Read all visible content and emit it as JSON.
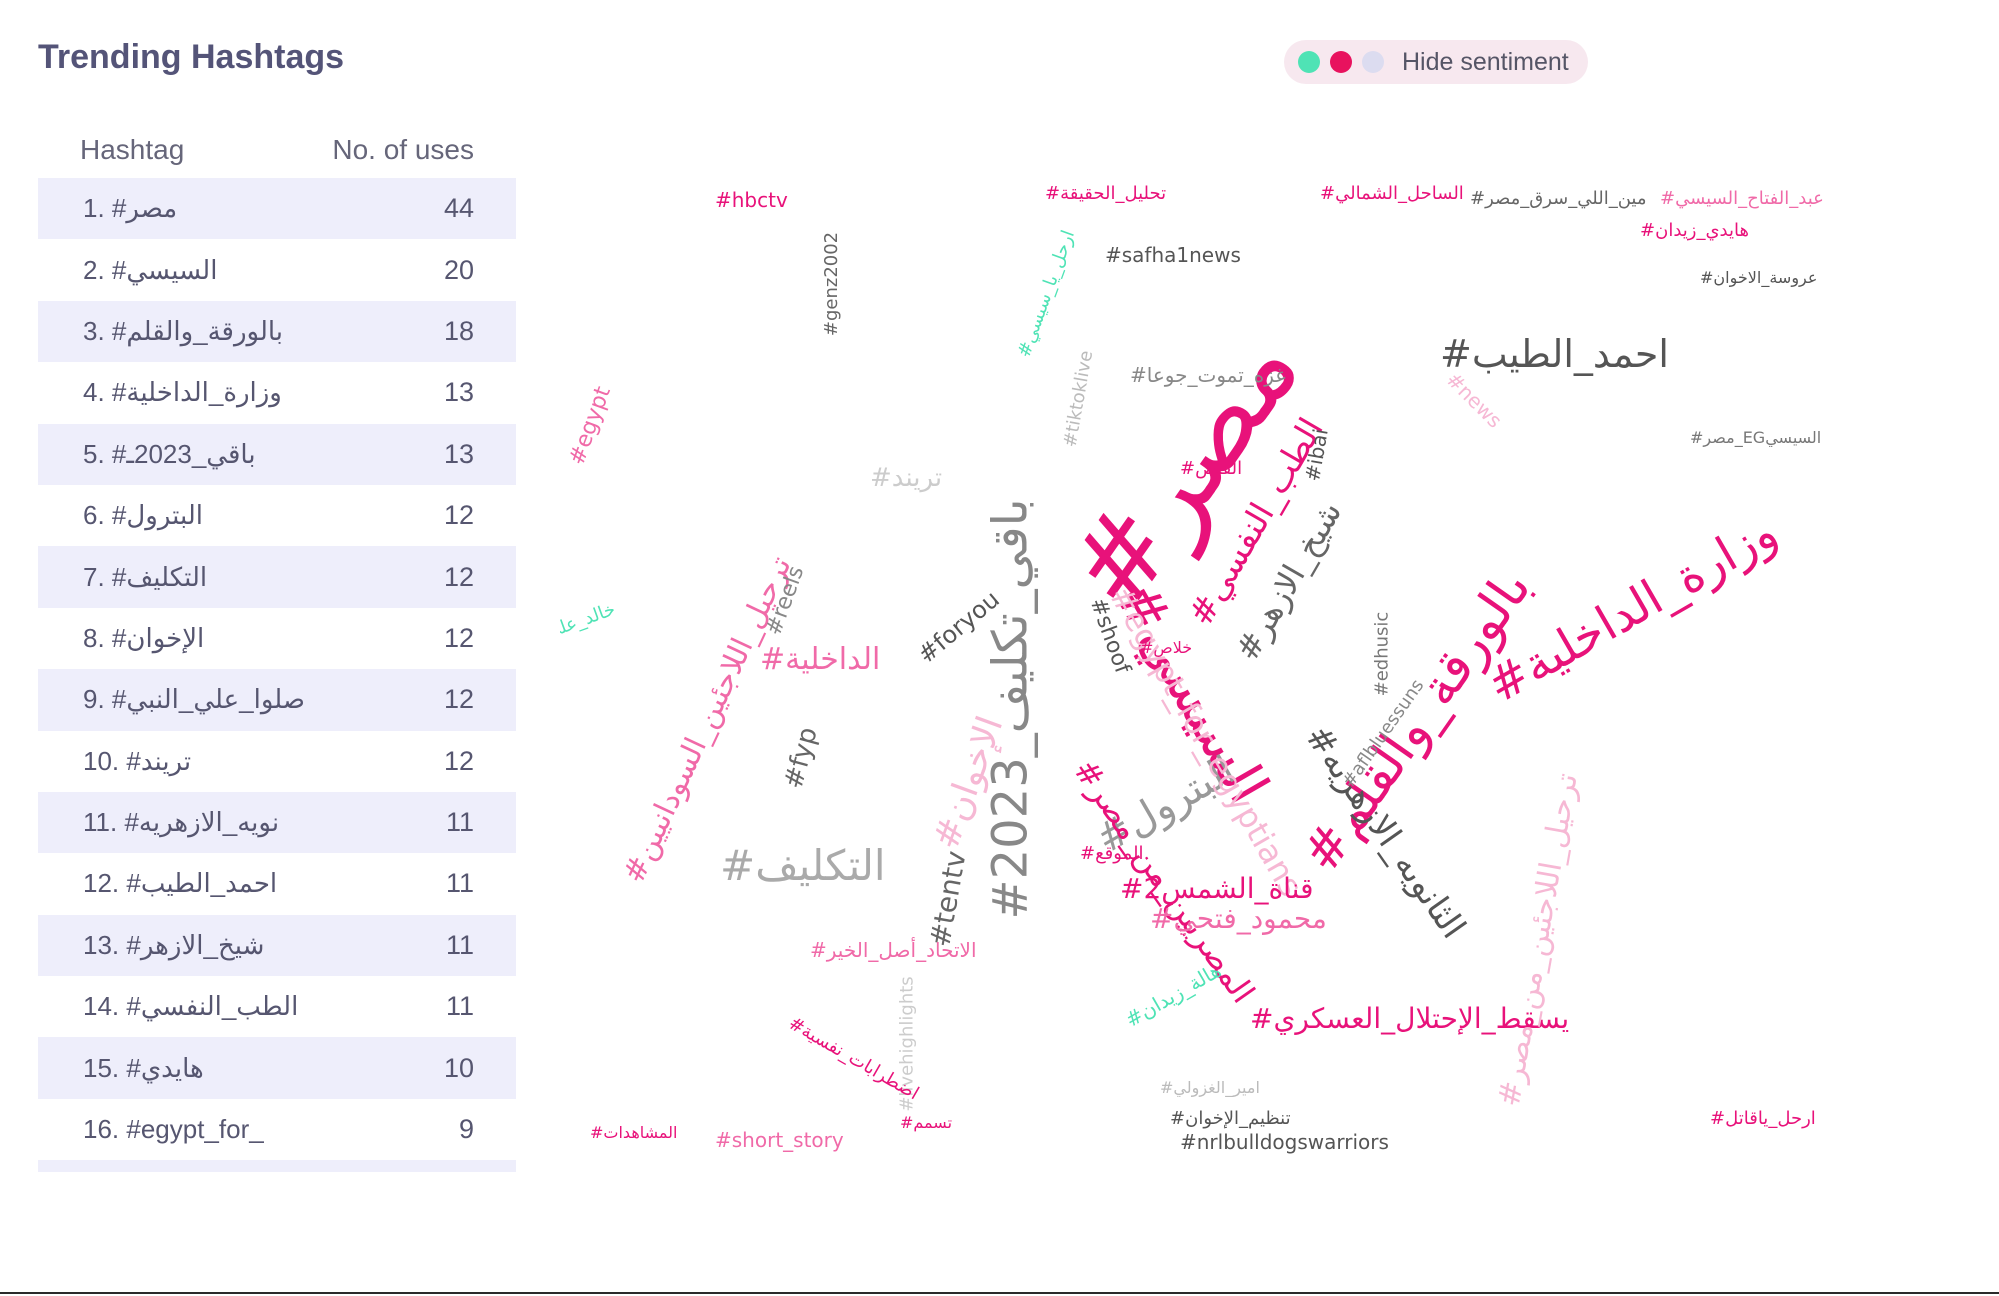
{
  "header": {
    "title": "Trending Hashtags"
  },
  "sentiment_toggle": {
    "label": "Hide sentiment",
    "colors": {
      "positive": "#4fe3b5",
      "negative": "#e8125e",
      "neutral": "#dcdcf0"
    }
  },
  "table": {
    "col_hashtag": "Hashtag",
    "col_uses": "No. of uses",
    "rows": [
      {
        "label": "1. #مصر",
        "uses": "44"
      },
      {
        "label": "2. #السيسي",
        "uses": "20"
      },
      {
        "label": "3. #بالورقة_والقلم",
        "uses": "18"
      },
      {
        "label": "4. #وزارة_الداخلية",
        "uses": "13"
      },
      {
        "label": "5. #باقي_2023ـ",
        "uses": "13"
      },
      {
        "label": "6. #البترول",
        "uses": "12"
      },
      {
        "label": "7. #التكليف",
        "uses": "12"
      },
      {
        "label": "8. #الإخوان",
        "uses": "12"
      },
      {
        "label": "9. #صلوا_علي_النبي",
        "uses": "12"
      },
      {
        "label": "10. #تريند",
        "uses": "12"
      },
      {
        "label": "11. #نويه_الازهريه",
        "uses": "11"
      },
      {
        "label": "12. #احمد_الطيب",
        "uses": "11"
      },
      {
        "label": "13. #شيخ_الازهر",
        "uses": "11"
      },
      {
        "label": "14. #الطب_النفسي",
        "uses": "11"
      },
      {
        "label": "15. #هايدي",
        "uses": "10"
      },
      {
        "label": "16. #egypt_for_",
        "uses": "9"
      }
    ]
  },
  "word_cloud": {
    "words": [
      {
        "text": "#مصر",
        "color": "#e8127a"
      },
      {
        "text": "#بالورقة_والقلم",
        "color": "#e8127a"
      },
      {
        "text": "#وزارة_الداخلية",
        "color": "#e8127a"
      },
      {
        "text": "#احمد_الطيب",
        "color": "#555555"
      },
      {
        "text": "#السيسي",
        "color": "#e8127a"
      },
      {
        "text": "#2023_باقي_تكليف",
        "color": "#888888"
      },
      {
        "text": "#التكليف",
        "color": "#aaaaaa"
      },
      {
        "text": "#البترول",
        "color": "#999999"
      },
      {
        "text": "#الداخلية",
        "color": "#f06aa8"
      },
      {
        "text": "#egypt_for_egyptians",
        "color": "#f6b8d4"
      },
      {
        "text": "#الإخوان",
        "color": "#f6b8d4"
      },
      {
        "text": "#الطب_النفسي",
        "color": "#e8127a"
      },
      {
        "text": "#شيخ_الازهر",
        "color": "#666666"
      },
      {
        "text": "#الثانويه_الازهريه",
        "color": "#555555"
      },
      {
        "text": "#يسقط_الإحتلال_العسكري",
        "color": "#e8127a"
      },
      {
        "text": "#ترحيل_اللاجئين_من_مصر",
        "color": "#f6b8d4"
      },
      {
        "text": "#ترحيل_اللاجئين_السودانيين",
        "color": "#f06aa8"
      },
      {
        "text": "#المصريين_من_مصر",
        "color": "#e8127a"
      },
      {
        "text": "#محمود_فتحي",
        "color": "#f06aa8"
      },
      {
        "text": "#قناة_الشمس2",
        "color": "#e8127a"
      },
      {
        "text": "#hbctv",
        "color": "#e8127a"
      },
      {
        "text": "#safha1news",
        "color": "#555555"
      },
      {
        "text": "#nrlbulldogswarriors",
        "color": "#555555"
      },
      {
        "text": "#short_story",
        "color": "#f06aa8"
      },
      {
        "text": "#foryou",
        "color": "#555555"
      },
      {
        "text": "#tentv",
        "color": "#666666"
      },
      {
        "text": "#fyp",
        "color": "#666666"
      },
      {
        "text": "#reels",
        "color": "#888888"
      },
      {
        "text": "#shoof",
        "color": "#555555"
      },
      {
        "text": "#ibai",
        "color": "#555555"
      },
      {
        "text": "#tiktoklive",
        "color": "#bbbbbb"
      },
      {
        "text": "#livehighlights",
        "color": "#cccccc"
      },
      {
        "text": "#edhusic",
        "color": "#777777"
      },
      {
        "text": "#aflbluessuns",
        "color": "#888888"
      },
      {
        "text": "#aflhawksdons",
        "color": "#f6b8d4"
      },
      {
        "text": "#egypt",
        "color": "#f06aa8"
      },
      {
        "text": "#genz2002",
        "color": "#666666"
      },
      {
        "text": "#news",
        "color": "#f6b8d4"
      },
      {
        "text": "#تحليل_الحقيقة",
        "color": "#e8127a"
      },
      {
        "text": "#الساحل_الشمالي",
        "color": "#e8127a"
      },
      {
        "text": "#مين_اللي_سرق_مصر",
        "color": "#666666"
      },
      {
        "text": "#عبد_الفتاح_السيسي",
        "color": "#f06aa8"
      },
      {
        "text": "#هايدي_زيدان",
        "color": "#e8127a"
      },
      {
        "text": "#غزه_تموت_جوعا",
        "color": "#888888"
      },
      {
        "text": "#تريند",
        "color": "#cccccc"
      },
      {
        "text": "#القبض",
        "color": "#e8127a"
      },
      {
        "text": "#خلاص",
        "color": "#e8127a"
      },
      {
        "text": "#ارحل_ياقاتل",
        "color": "#e8127a"
      },
      {
        "text": "#تنظيم_الإخوان",
        "color": "#555555"
      },
      {
        "text": "#امير_الغزولي",
        "color": "#bbbbbb"
      },
      {
        "text": "#المشاهدات",
        "color": "#e8127a"
      },
      {
        "text": "#مصر_EGالسيسي",
        "color": "#777777"
      },
      {
        "text": "#عروسة_الاخوان",
        "color": "#555555"
      },
      {
        "text": "#الاتحاد_أصل_الخير",
        "color": "#f06aa8"
      },
      {
        "text": "#اضطرابات_نفسية",
        "color": "#e8127a"
      },
      {
        "text": "#خالد_علي",
        "color": "#4fe3b5"
      },
      {
        "text": "#هالة_زيدان",
        "color": "#4fe3b5"
      },
      {
        "text": "#ارحل_يا_سيسي",
        "color": "#4fe3b5"
      },
      {
        "text": "#الموقع",
        "color": "#e8127a"
      },
      {
        "text": "#تسمم",
        "color": "#e8127a"
      }
    ]
  }
}
